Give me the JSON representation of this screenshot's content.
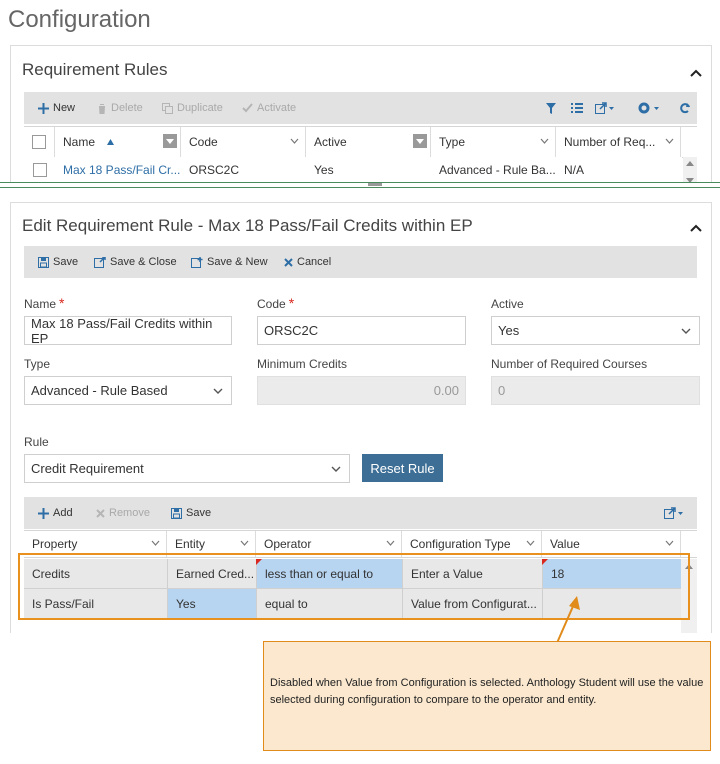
{
  "page": {
    "title": "Configuration"
  },
  "requirement_rules": {
    "title": "Requirement Rules",
    "toolbar": {
      "new": "New",
      "delete": "Delete",
      "duplicate": "Duplicate",
      "activate": "Activate"
    },
    "columns": [
      "Name",
      "Code",
      "Active",
      "Type",
      "Number of Req..."
    ],
    "rows": [
      {
        "name": "Max 18 Pass/Fail Cr...",
        "code": "ORSC2C",
        "active": "Yes",
        "type": "Advanced - Rule Ba...",
        "number": "N/A"
      }
    ]
  },
  "edit_rule": {
    "title": "Edit Requirement Rule - Max 18 Pass/Fail Credits within EP",
    "toolbar": {
      "save": "Save",
      "save_close": "Save & Close",
      "save_new": "Save & New",
      "cancel": "Cancel"
    },
    "fields": {
      "name_label": "Name",
      "name_value": "Max 18 Pass/Fail Credits within EP",
      "code_label": "Code",
      "code_value": "ORSC2C",
      "active_label": "Active",
      "active_value": "Yes",
      "type_label": "Type",
      "type_value": "Advanced - Rule Based",
      "min_credits_label": "Minimum Credits",
      "min_credits_value": "0.00",
      "num_courses_label": "Number of Required Courses",
      "num_courses_value": "0",
      "rule_label": "Rule",
      "rule_value": "Credit Requirement",
      "required_mark": "*"
    },
    "reset_rule": "Reset Rule",
    "grid_toolbar": {
      "add": "Add",
      "remove": "Remove",
      "save": "Save"
    },
    "grid_columns": [
      "Property",
      "Entity",
      "Operator",
      "Configuration Type",
      "Value"
    ],
    "grid_rows": [
      {
        "property": "Credits",
        "entity": "Earned Cred...",
        "operator": "less than or equal to",
        "config_type": "Enter a Value",
        "value": "18"
      },
      {
        "property": "Is Pass/Fail",
        "entity": "Yes",
        "operator": "equal to",
        "config_type": "Value from Configurat...",
        "value": ""
      }
    ]
  },
  "callout": {
    "text": "Disabled when Value from Configuration is selected. Anthology Student will use the value selected during configuration to compare to the operator and entity."
  },
  "colors": {
    "accent": "#3d6f96",
    "link": "#2e6ea6",
    "highlight": "#e8911f",
    "selected_cell": "#b7d4f0",
    "callout_bg": "#fbe8cf"
  }
}
